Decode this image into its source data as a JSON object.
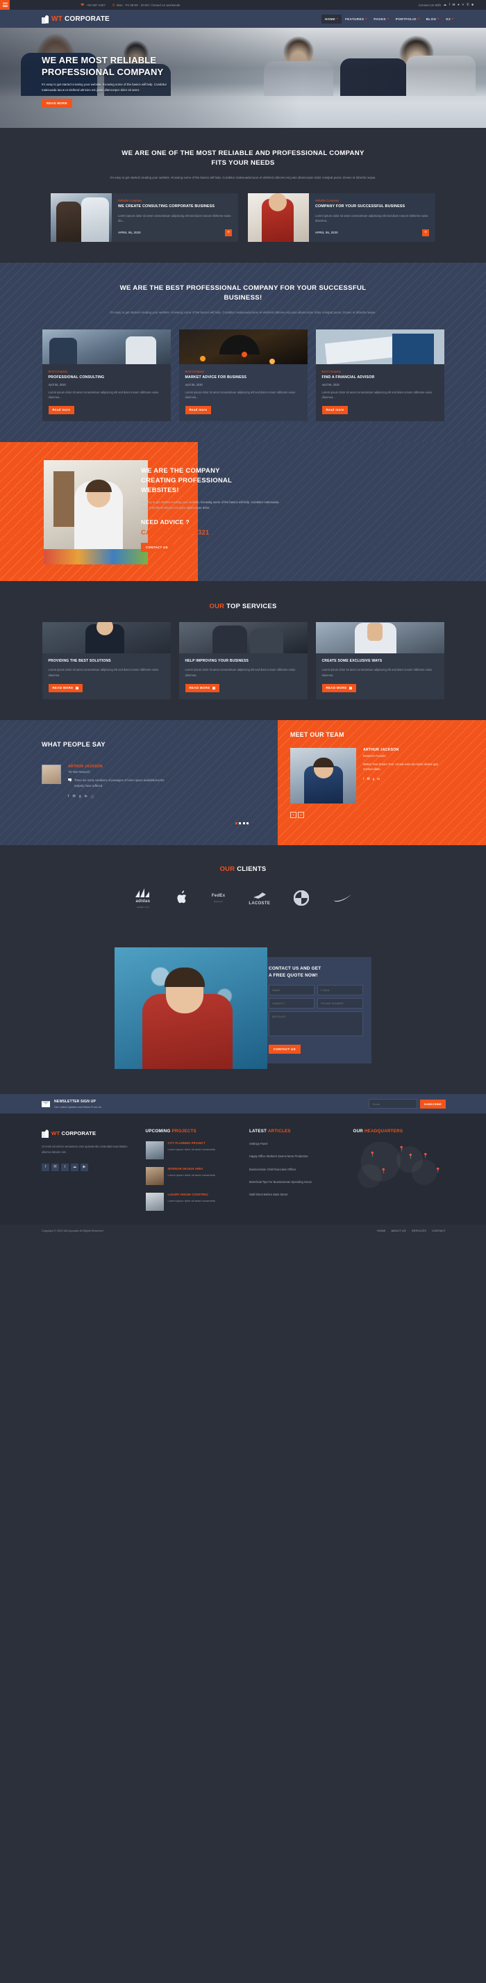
{
  "topbar": {
    "phone": "+00 587 2457",
    "hours": "Mon - Fri 08:00 - 20:00 / Closed on weekends",
    "connect_label": "Connect Us With",
    "socials": [
      "rss-icon",
      "facebook-icon",
      "twitter-icon",
      "dribbble-icon",
      "vimeo-icon",
      "skype-icon",
      "linkedin-icon"
    ]
  },
  "header": {
    "logo_a": "WT ",
    "logo_b": "CORPORATE",
    "nav": [
      {
        "label": "HOME",
        "active": true
      },
      {
        "label": "FEATURES",
        "active": false
      },
      {
        "label": "PAGES",
        "active": false
      },
      {
        "label": "PORTFOLIO",
        "active": false
      },
      {
        "label": "BLOG",
        "active": false
      },
      {
        "label": "K2",
        "active": false
      }
    ]
  },
  "hero": {
    "title_l1": "WE ARE MOST RELIABLE",
    "title_l2": "PROFESSIONAL COMPANY",
    "text": "It's easy to get started creating your website. Knowing some of the basics will help. Curabitur malesuada lacus et eleifend ultricies est justo ullamcorper dolor sit amet.",
    "cta": "READ MORE"
  },
  "reliable": {
    "title_l1": "WE ARE ONE OF THE MOST RELIABLE AND PROFESSIONAL COMPANY",
    "title_l2": "FITS YOUR NEEDS",
    "lead": "It's easy to get started creating your website. Knowing some of the basics will help. Curabitur malesuada lacus et eleifend ultricies est justo ullamcorper dolor volutpat purus. Donec et lobortis neque.",
    "cards": [
      {
        "kicker": "Reliable Company",
        "title": "WE CREATE CONSULTING CORPORATE BUSINESS",
        "text": "Lorem ipsum dolor sit amet consectetuer adipiscing elit sed diam nonum nibheme euiso dia...",
        "date": "APRIL 06, 2020",
        "plus": "+"
      },
      {
        "kicker": "Reliable Company",
        "title": "COMPANY FOR YOUR SUCCESSFUL BUSINESS",
        "text": "Lorem ipsum dolor sit amet consectetuer adipiscing elit sed diam nonum nibheme euiso diaemea...",
        "date": "APRIL 06, 2020",
        "plus": "+"
      }
    ]
  },
  "best": {
    "title_l1": "WE ARE THE BEST PROFESSIONAL COMPANY FOR YOUR SUCCESSFUL",
    "title_l2": "BUSINESS!",
    "lead": "It's easy to get started creating your website. Knowing some of the basics will help. Curabitur malesuada lacus et eleifend ultricies est justo ullamcorper dolor volutpat purus. Donec et lobortis neque.",
    "cards": [
      {
        "kicker": "Best Company",
        "title": "PROFESSIONAL CONSULTING",
        "date": "April 06, 2020",
        "text": "Lorem ipsum dolor sit amet consectetuer adipiscing elit sed diam nonum nibheme euiso diaemea...",
        "cta": "Read more"
      },
      {
        "kicker": "Best Company",
        "title": "MARKET ADVICE FOR BUSINESS",
        "date": "April 06, 2020",
        "text": "Lorem ipsum dolor sit amet consectetuer adipiscing elit sed diam nonum nibheme euiso diaemea...",
        "cta": "Read more"
      },
      {
        "kicker": "Best Company",
        "title": "FIND A FINANCIAL ADVISOR",
        "date": "April 06, 2020",
        "text": "Lorem ipsum dolor sit amet consectetuer adipiscing elit sed diam nonum nibheme euiso diaemea...",
        "cta": "Read more"
      }
    ]
  },
  "split": {
    "title_l1": "WE ARE THE COMPANY",
    "title_l2": "CREATING PROFESSIONAL",
    "title_l3": "WEBSITES!",
    "text": "It's easy to get started creating your website. Knowing some of the basics will help. Curabitur malesuada lacus et eleifend ultricies est justo ullamcorper dolor.",
    "need": "NEED ADVICE ?",
    "tel": "CALL: (123) 556 4321",
    "cta": "CONTACT US"
  },
  "top_services": {
    "title_o": "OUR ",
    "title_w": "TOP SERVICES",
    "cards": [
      {
        "title": "PROVIDING THE BEST SOLUTIONS",
        "text": "Lorem ipsum dolor sit amet consectetuer adipiscing elit sed diam nonum nibheme euiso diaemea.",
        "cta": "READ MORE"
      },
      {
        "title": "HELP IMPROVING YOUR BUSINESS",
        "text": "Lorem ipsum dolor sit amet consectetuer adipiscing elit sed diam nonum nibheme euiso diaemea.",
        "cta": "READ MORE"
      },
      {
        "title": "CREATE SOME EXCLUSIVE WAYS",
        "text": "Lorem ipsum dolor sit amet consectetuer adipiscing elit sed diam nonum nibheme euiso diaemea.",
        "cta": "READ MORE"
      }
    ]
  },
  "testimonial": {
    "heading": "WHAT PEOPLE SAY",
    "name": "ARTHUR JACKSON",
    "role": "TD Vast Newyork",
    "quote": "There are many variations of passages of lorem ipsum available,but the majority have suffered.",
    "socials": [
      "facebook-icon",
      "twitter-icon",
      "google-plus-icon",
      "linkedin-icon",
      "pinterest-icon"
    ],
    "dots": 4,
    "active_dot": 0
  },
  "team": {
    "heading": "MEET OUR TEAM",
    "name": "ARTHUR JACKSON",
    "role": "Business Founder",
    "text": "Makes Your Dream True: 18 wat enim ad minim denies quis nostrud ullam.",
    "socials": [
      "facebook-icon",
      "twitter-icon",
      "google-plus-icon",
      "linkedin-icon"
    ],
    "prev": "‹",
    "next": "›"
  },
  "clients": {
    "title_o": "OUR ",
    "title_w": "CLIENTS",
    "logos": [
      {
        "name": "adidas",
        "sub": "adidas.com"
      },
      {
        "name": "",
        "sub": ""
      },
      {
        "name": "FedEx",
        "sub": "Express"
      },
      {
        "name": "LACOSTE",
        "sub": ""
      },
      {
        "name": "BMW",
        "sub": ""
      },
      {
        "name": "NIKE",
        "sub": ""
      }
    ]
  },
  "contact": {
    "title_l1": "CONTACT US AND GET",
    "title_l2": "A FREE QUOTE NOW!",
    "fields": {
      "name": "NAME",
      "email": "E MAIL",
      "subject": "SUBJECT",
      "phone": "PHONE NUMBER",
      "message": "MESSAGE"
    },
    "cta": "CONTACT US"
  },
  "newsletter": {
    "title": "NEWSLETTER SIGN UP",
    "subtitle": "Get Latest Updates and News From Us",
    "placeholder": "Email",
    "button": "SUBSCRIBE"
  },
  "footer": {
    "logo_a": "WT ",
    "logo_b": "CORPORATE",
    "about": "Ut enim ad minim veniamore este quisetende nostrudad exercitation ullamco laboris nisi.",
    "socials": [
      "facebook-icon",
      "twitter-icon",
      "tumblr-icon",
      "rss-icon",
      "youtube-icon"
    ],
    "projects_h_w": "UPCOMING ",
    "projects_h_o": "PROJECTS",
    "projects": [
      {
        "title": "CITY PLANNING PROJECT",
        "text": "Lorem ipsum dolor sit amet consectetu"
      },
      {
        "title": "INTERIOR DESIGN AREA",
        "text": "Lorem ipsum dolor sit amet consectetu"
      },
      {
        "title": "LUXURY HOUSE CONSTRUC",
        "text": "Lorem ipsum dolor sit amet consectetu"
      }
    ],
    "articles_h_w": "LATEST ",
    "articles_h_o": "ARTICLES",
    "articles": [
      "Settings Panel",
      "Happy Office Workers Seems More Productive",
      "Businessman Chief Executive Officer",
      "Beneficial Tips For Businessman Spending Hours",
      "Wall Street Before Main Street"
    ],
    "hq_h_w": "OUR ",
    "hq_h_o": "HEADQUARTERS"
  },
  "bottom": {
    "copyright": "Copyright ©  2020  WtCorporate All Rights Reserved",
    "links": [
      "HOME",
      "ABOUT US",
      "SERVICES",
      "CONTACT"
    ]
  }
}
